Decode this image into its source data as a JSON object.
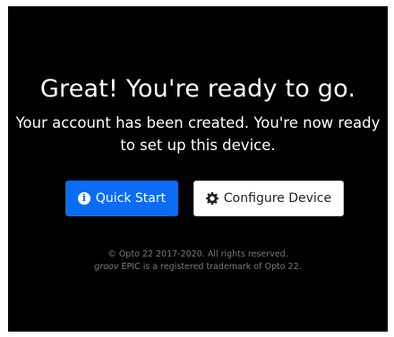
{
  "main": {
    "title": "Great! You're ready to go.",
    "subtitle": "Your account has been created. You're now ready to set up this device."
  },
  "actions": {
    "quick_start_label": "Quick Start",
    "configure_label": "Configure Device",
    "quick_start_icon": "info-circle-icon",
    "configure_icon": "gear-icon",
    "primary_color": "#0b6cf5"
  },
  "footer": {
    "copyright": "© Opto 22 2017-2020. All rights reserved.",
    "brand_prefix": "groov",
    "trademark_text": " EPIC is a registered trademark of Opto 22."
  }
}
